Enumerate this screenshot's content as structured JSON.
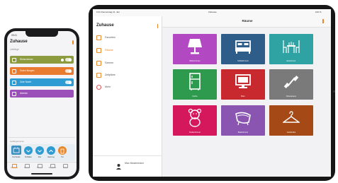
{
  "phone": {
    "status_time": "09:41",
    "title": "Zuhause",
    "subtitle": "Lieblinge",
    "scenes": [
      {
        "label": "Wohnzimmer",
        "color": "#8c9b3e"
      },
      {
        "label": "Guten Morgen",
        "color": "#e87b30"
      },
      {
        "label": "Gute Nacht",
        "color": "#2e9bd3"
      },
      {
        "label": "Abends",
        "color": "#9b4fb8"
      }
    ],
    "favorites_header": "Lieblingsszenen",
    "favorites": [
      "Kochzeile",
      "Schlafen",
      "Flur",
      "Heizung",
      "Tür"
    ],
    "tabs": [
      "Zuhause",
      "Räume",
      "Szenen",
      "Zeitpläne",
      "Mehr"
    ]
  },
  "ipad": {
    "status_left": "9:41  Donnerstag 21. Jan",
    "status_center": "Zuhause",
    "status_right": "100 %",
    "sidebar_title": "Zuhause",
    "nav": [
      {
        "label": "Favoriten",
        "icon": "star-icon"
      },
      {
        "label": "Räume",
        "icon": "room-icon",
        "active": true
      },
      {
        "label": "Szenen",
        "icon": "scene-icon"
      },
      {
        "label": "Zeitpläne",
        "icon": "clock-icon"
      },
      {
        "label": "Mehr",
        "icon": "more-icon"
      }
    ],
    "user_name": "Max Mustermann",
    "header_title": "Räume",
    "rooms": [
      {
        "label": "Wohnzimmer",
        "color": "#b349c2",
        "icon": "lamp-icon"
      },
      {
        "label": "Schlafzimmer",
        "color": "#2f5d8a",
        "icon": "bed-icon"
      },
      {
        "label": "Esszimmer",
        "color": "#2fa3a3",
        "icon": "dining-icon"
      },
      {
        "label": "Küche",
        "color": "#2e9a4e",
        "icon": "fridge-icon"
      },
      {
        "label": "Büro",
        "color": "#c8292e",
        "icon": "computer-icon"
      },
      {
        "label": "Fitnessraum",
        "color": "#7a7a7a",
        "icon": "dumbbell-icon"
      },
      {
        "label": "Kinderzimmer",
        "color": "#d5185b",
        "icon": "teddy-icon"
      },
      {
        "label": "Badezimmer",
        "color": "#8a55b0",
        "icon": "bathtub-icon"
      },
      {
        "label": "Garderobe",
        "color": "#a54a16",
        "icon": "hanger-icon"
      }
    ]
  }
}
